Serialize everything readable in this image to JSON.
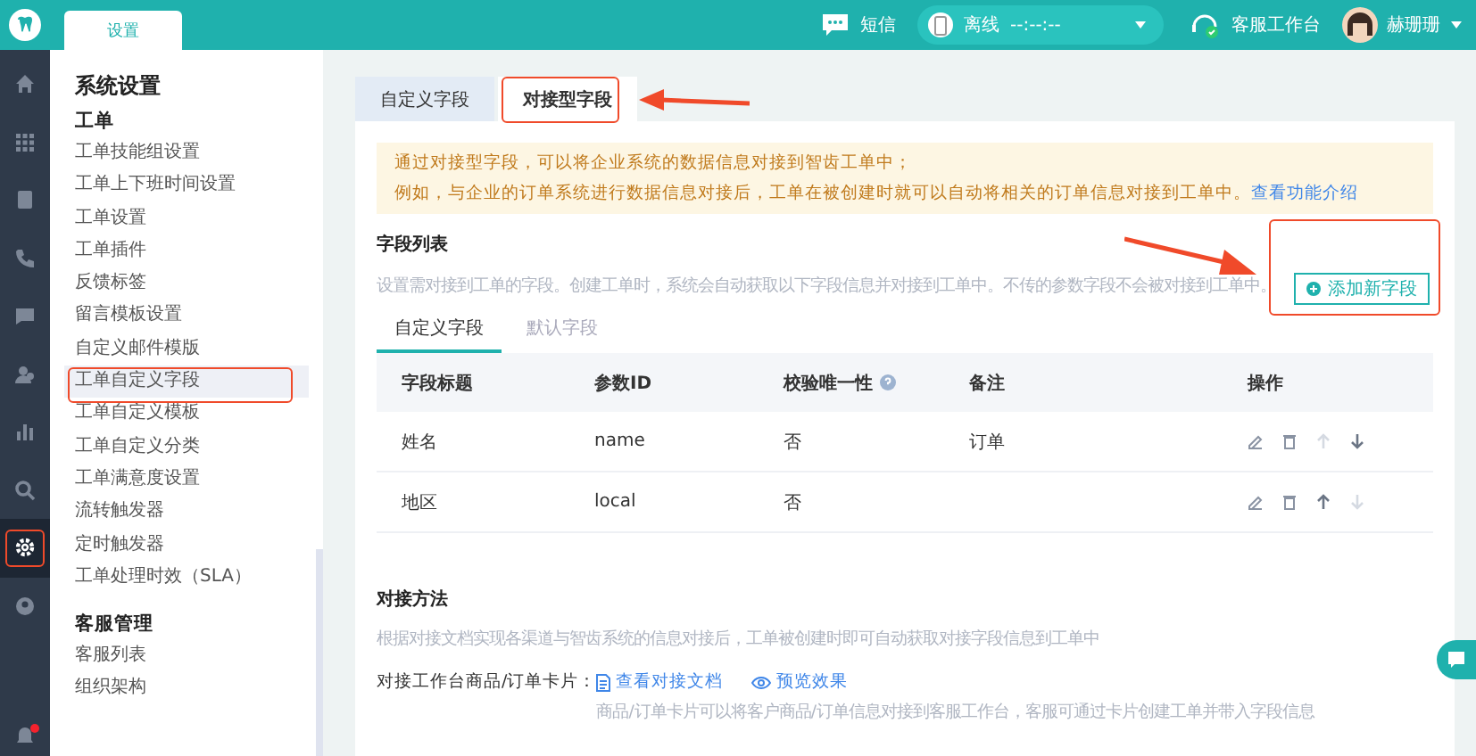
{
  "topbar": {
    "tabs": [
      {
        "label": "设置",
        "selected": true
      }
    ],
    "sms": "短信",
    "status": "离线",
    "timer": "--:--:--",
    "workbench": "客服工作台",
    "user": "赫珊珊"
  },
  "rail": [
    {
      "kind": "home",
      "selected": false
    },
    {
      "kind": "grid",
      "selected": false
    },
    {
      "kind": "book",
      "selected": false
    },
    {
      "kind": "phone",
      "selected": false
    },
    {
      "kind": "chat",
      "selected": false
    },
    {
      "kind": "user",
      "selected": false
    },
    {
      "kind": "chart",
      "selected": false
    },
    {
      "kind": "search",
      "selected": false
    },
    {
      "kind": "gear",
      "selected": true
    },
    {
      "kind": "circle",
      "selected": false
    }
  ],
  "rail_bell": {
    "badge": true
  },
  "sidebar": {
    "title": "系统设置",
    "groups": [
      {
        "title": "工单",
        "items": [
          {
            "label": "工单技能组设置",
            "selected": false
          },
          {
            "label": "工单上下班时间设置",
            "selected": false
          },
          {
            "label": "工单设置",
            "selected": false
          },
          {
            "label": "工单插件",
            "selected": false
          },
          {
            "label": "反馈标签",
            "selected": false
          },
          {
            "label": "留言模板设置",
            "selected": false
          },
          {
            "label": "自定义邮件模版",
            "selected": false
          },
          {
            "label": "工单自定义字段",
            "selected": true
          },
          {
            "label": "工单自定义模板",
            "selected": false
          },
          {
            "label": "工单自定义分类",
            "selected": false
          },
          {
            "label": "工单满意度设置",
            "selected": false
          },
          {
            "label": "流转触发器",
            "selected": false
          },
          {
            "label": "定时触发器",
            "selected": false
          },
          {
            "label": "工单处理时效（SLA）",
            "selected": false
          }
        ]
      },
      {
        "title": "客服管理",
        "items": [
          {
            "label": "客服列表",
            "selected": false
          },
          {
            "label": "组织架构",
            "selected": false
          }
        ]
      }
    ]
  },
  "tabs": [
    {
      "label": "自定义字段",
      "selected": false
    },
    {
      "label": "对接型字段",
      "selected": true
    }
  ],
  "notice": {
    "line1": "通过对接型字段，可以将企业系统的数据信息对接到智齿工单中；",
    "line2": "例如，与企业的订单系统进行数据信息对接后，工单在被创建时就可以自动将相关的订单信息对接到工单中。",
    "link": "查看功能介绍"
  },
  "fields": {
    "title": "字段列表",
    "description": "设置需对接到工单的字段。创建工单时，系统会自动获取以下字段信息并对接到工单中。不传的参数字段不会被对接到工单中。",
    "add_button": "添加新字段",
    "subtabs": [
      {
        "label": "自定义字段",
        "selected": true
      },
      {
        "label": "默认字段",
        "selected": false
      }
    ],
    "columns": [
      "字段标题",
      "参数ID",
      "校验唯一性",
      "备注",
      "操作"
    ],
    "rows": [
      {
        "title": "姓名",
        "param": "name",
        "unique": "否",
        "note": "订单",
        "can_up": false,
        "can_down": true
      },
      {
        "title": "地区",
        "param": "local",
        "unique": "否",
        "note": "",
        "can_up": true,
        "can_down": false
      }
    ]
  },
  "method": {
    "title": "对接方法",
    "description": "根据对接文档实现各渠道与智齿系统的信息对接后，工单被创建时即可自动获取对接字段信息到工单中",
    "label": "对接工作台商品/订单卡片：",
    "doc_link": "查看对接文档",
    "preview_link": "预览效果",
    "hint": "商品/订单卡片可以将客户商品/订单信息对接到客服工作台，客服可通过卡片创建工单并带入字段信息"
  }
}
